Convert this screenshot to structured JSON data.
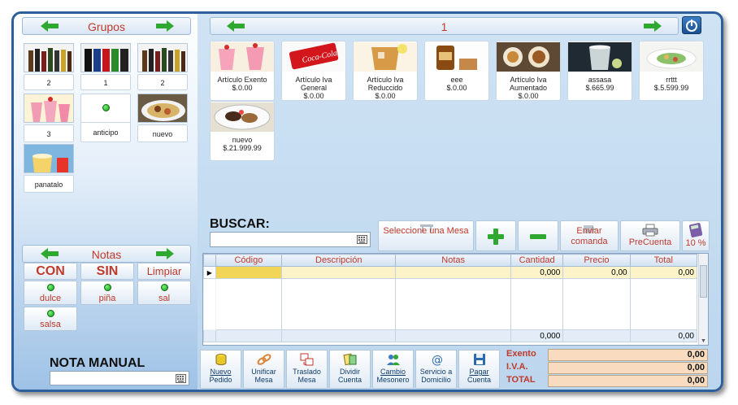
{
  "groups": {
    "title": "Grupos",
    "items": [
      {
        "label": "2"
      },
      {
        "label": "1"
      },
      {
        "label": "2"
      },
      {
        "label": "3"
      },
      {
        "label": "anticipo"
      },
      {
        "label": "nuevo"
      },
      {
        "label": "panatalo"
      }
    ]
  },
  "products_header": {
    "page": "1"
  },
  "products": [
    {
      "name": "Artículo Exento",
      "price": "$.0.00"
    },
    {
      "name": "Artículo Iva General",
      "price": "$.0.00"
    },
    {
      "name": "Artículo Iva Reduccido",
      "price": "$.0.00"
    },
    {
      "name": "eee",
      "price": "$.0.00"
    },
    {
      "name": "Artículo Iva Aumentado",
      "price": "$.0.00"
    },
    {
      "name": "assasa",
      "price": "$.665.99"
    },
    {
      "name": "rrttt",
      "price": "$.5.599.99"
    },
    {
      "name": "nuevo",
      "price": "$.21.999.99"
    }
  ],
  "search": {
    "label": "BUSCAR:",
    "value": ""
  },
  "actions": {
    "select_table": "Seleccione una Mesa",
    "send_order": "Enviar comanda",
    "pre_bill": "PreCuenta",
    "percent": "10 %"
  },
  "notes": {
    "title": "Notas",
    "con": "CON",
    "sin": "SIN",
    "clear": "Limpiar",
    "items": [
      "dulce",
      "piña",
      "sal",
      "salsa"
    ]
  },
  "manual_note": {
    "label": "NOTA MANUAL",
    "value": ""
  },
  "table": {
    "columns": [
      "Código",
      "Descripción",
      "Notas",
      "Cantidad",
      "Precio",
      "Total"
    ],
    "row": {
      "cantidad": "0,000",
      "precio": "0,00",
      "total": "0,00"
    },
    "footer": {
      "cantidad": "0,000",
      "total": "0,00"
    }
  },
  "footer_buttons": [
    {
      "line1": "Nuevo",
      "line2": "Pedido"
    },
    {
      "line1": "Unificar",
      "line2": "Mesa"
    },
    {
      "line1": "Traslado",
      "line2": "Mesa"
    },
    {
      "line1": "Dividir",
      "line2": "Cuenta"
    },
    {
      "line1": "Cambio",
      "line2": "Mesonero"
    },
    {
      "line1": "Servicio a",
      "line2": "Domicilio"
    },
    {
      "line1": "Pagar",
      "line2": "Cuenta"
    }
  ],
  "totals": {
    "exento_label": "Exento",
    "exento": "0,00",
    "iva_label": "I.V.A.",
    "iva": "0,00",
    "total_label": "TOTAL",
    "total": "0,00"
  },
  "colors": {
    "accent_red": "#c0392b",
    "nav_green": "#2ea82e",
    "frame_blue": "#2e5f9a"
  }
}
